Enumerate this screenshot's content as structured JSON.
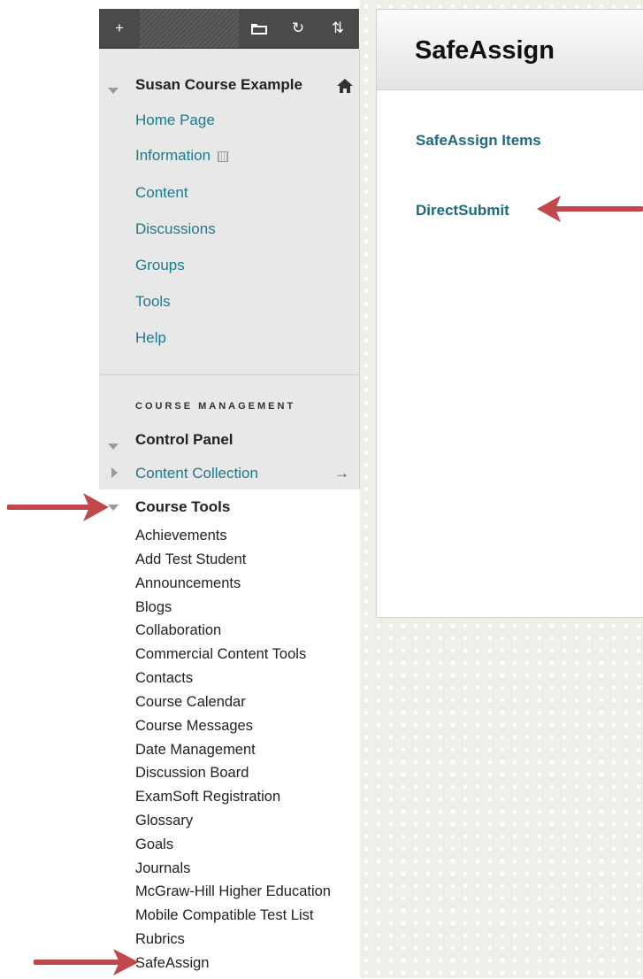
{
  "toolbar": {
    "add_icon": "+",
    "folder_icon": "folder-icon",
    "refresh_icon": "↻",
    "sort_icon": "⇅"
  },
  "course": {
    "title": "Susan Course Example",
    "links": [
      "Home Page",
      "Information",
      "Content",
      "Discussions",
      "Groups",
      "Tools",
      "Help"
    ]
  },
  "management": {
    "label": "COURSE MANAGEMENT",
    "control_panel": "Control Panel",
    "content_collection": "Content Collection",
    "content_collection_arrow": "→",
    "course_tools": "Course Tools",
    "tools": [
      "Achievements",
      "Add Test Student",
      "Announcements",
      "Blogs",
      "Collaboration",
      "Commercial Content Tools",
      "Contacts",
      "Course Calendar",
      "Course Messages",
      "Date Management",
      "Discussion Board",
      "ExamSoft Registration",
      "Glossary",
      "Goals",
      "Journals",
      "McGraw-Hill Higher Education",
      "Mobile Compatible Test List",
      "Rubrics",
      "SafeAssign"
    ]
  },
  "main": {
    "title": "SafeAssign",
    "links": [
      "SafeAssign Items",
      "DirectSubmit"
    ]
  },
  "colors": {
    "link": "#1d7a8c",
    "arrow": "#c0474a",
    "toolbar": "#4a4a4a"
  }
}
